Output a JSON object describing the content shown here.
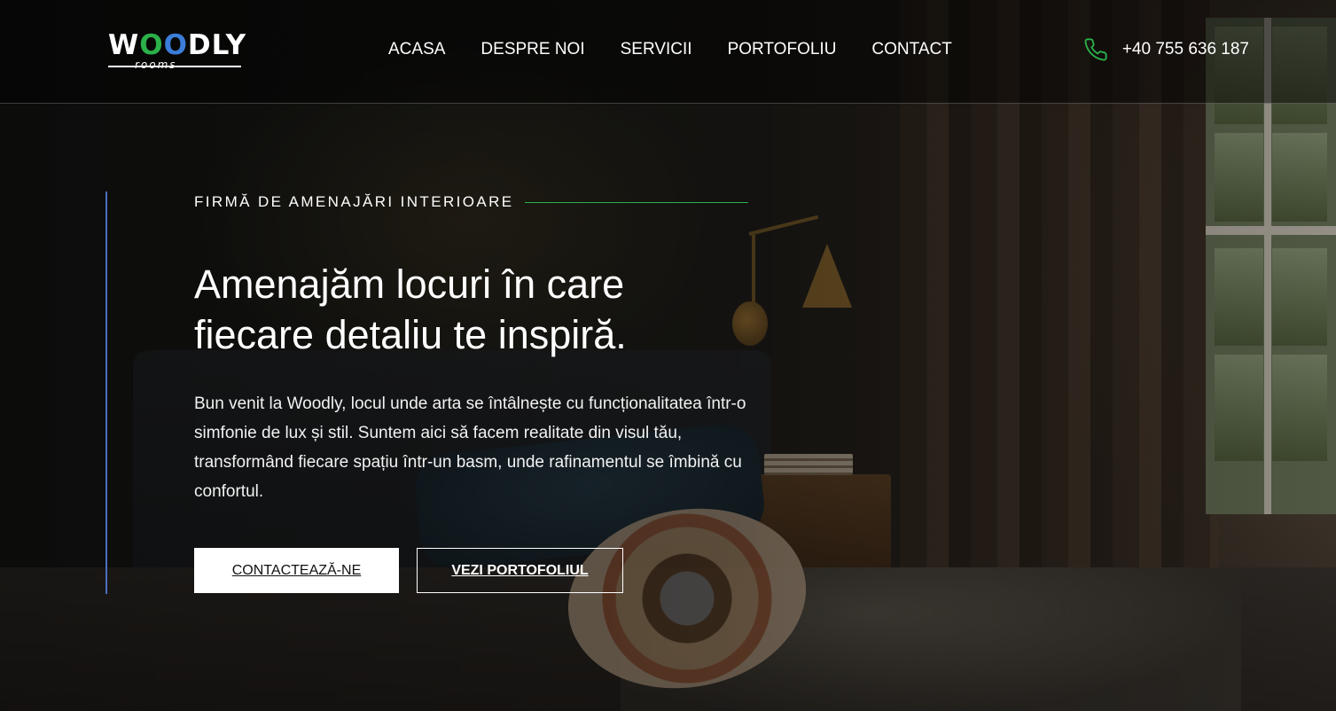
{
  "brand": {
    "logo_word": "WOODLY",
    "logo_sub": "rooms",
    "colors": {
      "green": "#2bb04a",
      "blue": "#3b7dd8"
    }
  },
  "nav": {
    "items": [
      "ACASA",
      "DESPRE NOI",
      "SERVICII",
      "PORTOFOLIU",
      "CONTACT"
    ]
  },
  "contact": {
    "phone": "+40 755 636 187",
    "icon": "phone-icon"
  },
  "hero": {
    "eyebrow": "FIRMĂ DE AMENAJĂRI INTERIOARE",
    "headline_line1": "Amenajăm locuri în care",
    "headline_line2": "fiecare detaliu te inspiră.",
    "lead": "Bun venit la Woodly, locul unde arta se întâlnește cu funcționalitatea într-o simfonie de lux și stil. Suntem aici să facem realitate din visul tău, transformând fiecare spațiu într-un basm, unde rafinamentul se îmbină cu confortul.",
    "cta_primary": "CONTACTEAZĂ-NE",
    "cta_secondary": "VEZI PORTOFOLIUL"
  }
}
